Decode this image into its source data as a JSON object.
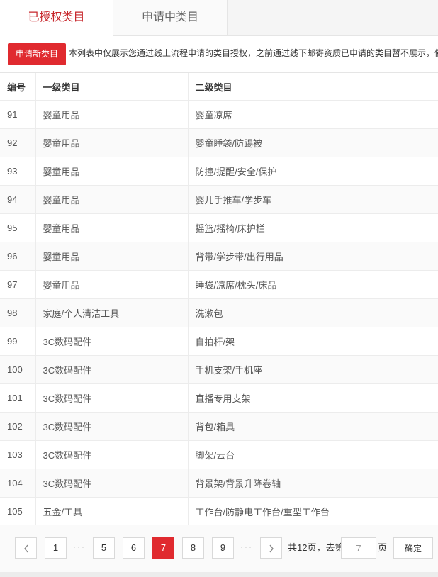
{
  "tabs": [
    {
      "label": "已授权类目"
    },
    {
      "label": "申请中类目"
    }
  ],
  "notice": {
    "button_label": "申请新类目",
    "text": "本列表中仅展示您通过线上流程申请的类目授权，之前通过线下邮寄资质已申请的类目暂不展示，催"
  },
  "table": {
    "headers": [
      "编号",
      "一级类目",
      "二级类目"
    ],
    "rows": [
      [
        "91",
        "婴童用品",
        "婴童凉席"
      ],
      [
        "92",
        "婴童用品",
        "婴童睡袋/防踢被"
      ],
      [
        "93",
        "婴童用品",
        "防撞/提醒/安全/保护"
      ],
      [
        "94",
        "婴童用品",
        "婴儿手推车/学步车"
      ],
      [
        "95",
        "婴童用品",
        "摇篮/摇椅/床护栏"
      ],
      [
        "96",
        "婴童用品",
        "背带/学步带/出行用品"
      ],
      [
        "97",
        "婴童用品",
        "睡袋/凉席/枕头/床品"
      ],
      [
        "98",
        "家庭/个人清洁工具",
        "洗漱包"
      ],
      [
        "99",
        "3C数码配件",
        "自拍杆/架"
      ],
      [
        "100",
        "3C数码配件",
        "手机支架/手机座"
      ],
      [
        "101",
        "3C数码配件",
        "直播专用支架"
      ],
      [
        "102",
        "3C数码配件",
        "背包/箱具"
      ],
      [
        "103",
        "3C数码配件",
        "脚架/云台"
      ],
      [
        "104",
        "3C数码配件",
        "背景架/背景升降卷轴"
      ],
      [
        "105",
        "五金/工具",
        "工作台/防静电工作台/重型工作台"
      ]
    ]
  },
  "pagination": {
    "pages": [
      "1",
      "5",
      "6",
      "7",
      "8",
      "9"
    ],
    "current": "7",
    "ellipsis": "···",
    "total_text": "共12页，去第",
    "page_unit": "页",
    "goto_value": "7",
    "confirm_label": "确定"
  },
  "colors": {
    "accent": "#e02a2f",
    "active_tab_text": "#c7262b"
  },
  "icons": {
    "prev": "chevron-left-icon",
    "next": "chevron-right-icon"
  }
}
